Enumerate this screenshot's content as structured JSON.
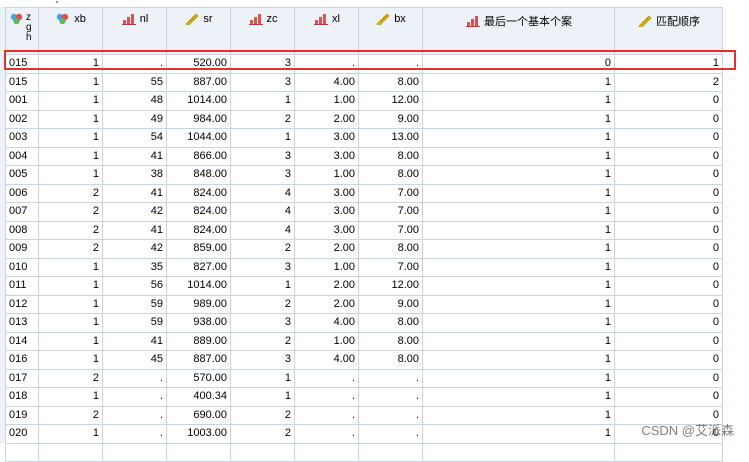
{
  "columns": [
    {
      "key": "zgh",
      "label_letters": [
        "z",
        "g",
        "h"
      ],
      "icon": "nominal-icon"
    },
    {
      "key": "xb",
      "label": "xb",
      "icon": "nominal-icon"
    },
    {
      "key": "nl",
      "label": "nl",
      "icon": "ordinal-icon"
    },
    {
      "key": "sr",
      "label": "sr",
      "icon": "scale-icon"
    },
    {
      "key": "zc",
      "label": "zc",
      "icon": "ordinal-icon"
    },
    {
      "key": "xl",
      "label": "xl",
      "icon": "ordinal-icon"
    },
    {
      "key": "bx",
      "label": "bx",
      "icon": "scale-icon"
    },
    {
      "key": "last",
      "label": "最后一个基本个案",
      "icon": "ordinal-icon"
    },
    {
      "key": "order",
      "label": "匹配顺序",
      "icon": "scale-icon"
    }
  ],
  "rows": [
    [
      "015",
      "1",
      ".",
      "520.00",
      "3",
      ".",
      ".",
      "0",
      "1"
    ],
    [
      "015",
      "1",
      "55",
      "887.00",
      "3",
      "4.00",
      "8.00",
      "1",
      "2"
    ],
    [
      "001",
      "1",
      "48",
      "1014.00",
      "1",
      "1.00",
      "12.00",
      "1",
      "0"
    ],
    [
      "002",
      "1",
      "49",
      "984.00",
      "2",
      "2.00",
      "9.00",
      "1",
      "0"
    ],
    [
      "003",
      "1",
      "54",
      "1044.00",
      "1",
      "3.00",
      "13.00",
      "1",
      "0"
    ],
    [
      "004",
      "1",
      "41",
      "866.00",
      "3",
      "3.00",
      "8.00",
      "1",
      "0"
    ],
    [
      "005",
      "1",
      "38",
      "848.00",
      "3",
      "1.00",
      "8.00",
      "1",
      "0"
    ],
    [
      "006",
      "2",
      "41",
      "824.00",
      "4",
      "3.00",
      "7.00",
      "1",
      "0"
    ],
    [
      "007",
      "2",
      "42",
      "824.00",
      "4",
      "3.00",
      "7.00",
      "1",
      "0"
    ],
    [
      "008",
      "2",
      "41",
      "824.00",
      "4",
      "3.00",
      "7.00",
      "1",
      "0"
    ],
    [
      "009",
      "2",
      "42",
      "859.00",
      "2",
      "2.00",
      "8.00",
      "1",
      "0"
    ],
    [
      "010",
      "1",
      "35",
      "827.00",
      "3",
      "1.00",
      "7.00",
      "1",
      "0"
    ],
    [
      "011",
      "1",
      "56",
      "1014.00",
      "1",
      "2.00",
      "12.00",
      "1",
      "0"
    ],
    [
      "012",
      "1",
      "59",
      "989.00",
      "2",
      "2.00",
      "9.00",
      "1",
      "0"
    ],
    [
      "013",
      "1",
      "59",
      "938.00",
      "3",
      "4.00",
      "8.00",
      "1",
      "0"
    ],
    [
      "014",
      "1",
      "41",
      "889.00",
      "2",
      "1.00",
      "8.00",
      "1",
      "0"
    ],
    [
      "016",
      "1",
      "45",
      "887.00",
      "3",
      "4.00",
      "8.00",
      "1",
      "0"
    ],
    [
      "017",
      "2",
      ".",
      "570.00",
      "1",
      ".",
      ".",
      "1",
      "0"
    ],
    [
      "018",
      "1",
      ".",
      "400.34",
      "1",
      ".",
      ".",
      "1",
      "0"
    ],
    [
      "019",
      "2",
      ".",
      "690.00",
      "2",
      ".",
      ".",
      "1",
      "0"
    ],
    [
      "020",
      "1",
      ".",
      "1003.00",
      "2",
      ".",
      ".",
      "1",
      "0"
    ],
    [
      "",
      "",
      "",
      "",
      "",
      "",
      "",
      "",
      ""
    ]
  ],
  "highlight_color": "#e2322f",
  "watermark": "CSDN @艾派森"
}
